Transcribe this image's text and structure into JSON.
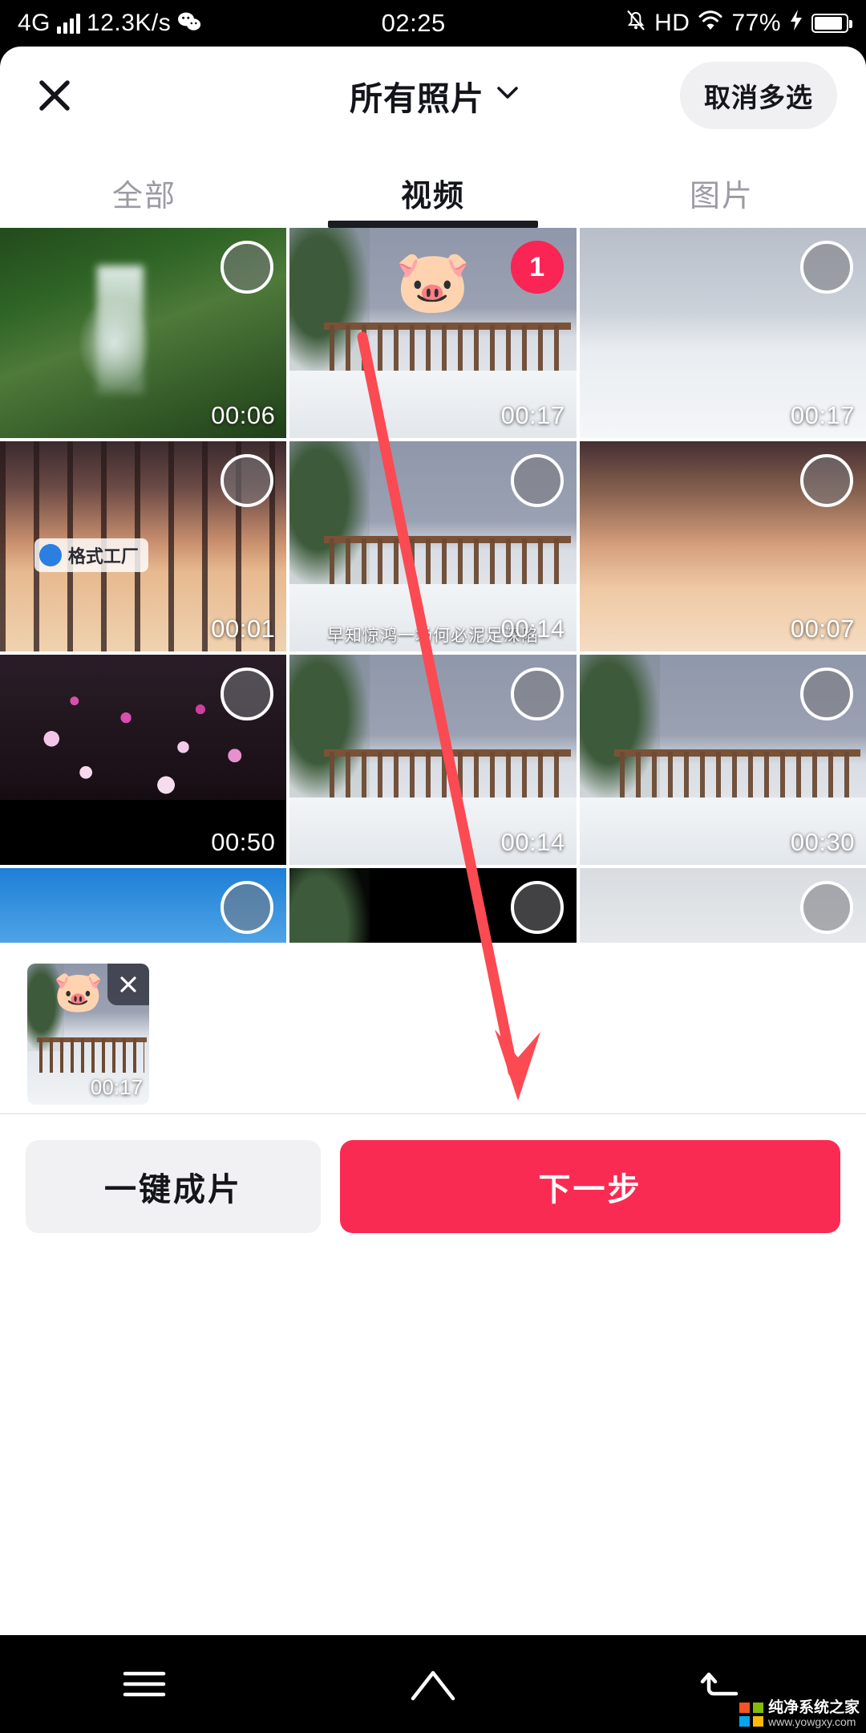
{
  "status_bar": {
    "network_type": "4G",
    "data_rate": "12.3K/s",
    "app_icon": "wechat-icon",
    "time": "02:25",
    "mute_icon": "bell-muted-icon",
    "hd_label": "HD",
    "wifi_icon": "wifi-icon",
    "battery_percent": "77%",
    "charging_icon": "lightning-bolt-icon"
  },
  "header": {
    "close_icon": "close-icon",
    "title": "所有照片",
    "chevron_icon": "chevron-down-icon",
    "multi_select_button": "取消多选"
  },
  "tabs": [
    {
      "label": "全部",
      "active": false
    },
    {
      "label": "视频",
      "active": true
    },
    {
      "label": "图片",
      "active": false
    }
  ],
  "grid": {
    "items": [
      {
        "duration": "00:06",
        "selected": false,
        "badge": "",
        "art": "t-waterfall",
        "sticker": "",
        "watermark": "",
        "caption": ""
      },
      {
        "duration": "00:17",
        "selected": true,
        "badge": "1",
        "art": "t-snow",
        "sticker": "🐷",
        "watermark": "",
        "caption": ""
      },
      {
        "duration": "00:17",
        "selected": false,
        "badge": "",
        "art": "t-snow2",
        "sticker": "",
        "watermark": "",
        "caption": ""
      },
      {
        "duration": "00:01",
        "selected": false,
        "badge": "",
        "art": "t-sunset",
        "sticker": "",
        "watermark": "格式工厂",
        "caption": ""
      },
      {
        "duration": "00:14",
        "selected": false,
        "badge": "",
        "art": "t-snow",
        "sticker": "",
        "watermark": "",
        "caption": "早知惊鸿一场何必泥足深陷"
      },
      {
        "duration": "00:07",
        "selected": false,
        "badge": "",
        "art": "t-sunset2",
        "sticker": "",
        "watermark": "",
        "caption": ""
      },
      {
        "duration": "00:50",
        "selected": false,
        "badge": "",
        "art": "t-blossom",
        "sticker": "",
        "watermark": "",
        "caption": ""
      },
      {
        "duration": "00:14",
        "selected": false,
        "badge": "",
        "art": "t-snow",
        "sticker": "",
        "watermark": "",
        "caption": ""
      },
      {
        "duration": "00:30",
        "selected": false,
        "badge": "",
        "art": "t-snow",
        "sticker": "",
        "watermark": "",
        "caption": ""
      },
      {
        "duration": "",
        "selected": false,
        "badge": "",
        "art": "t-birds",
        "sticker": "",
        "watermark": "",
        "caption": ""
      },
      {
        "duration": "",
        "selected": false,
        "badge": "",
        "art": "t-snow",
        "sticker": "",
        "watermark": "",
        "caption": ""
      },
      {
        "duration": "",
        "selected": false,
        "badge": "",
        "art": "t-clouds",
        "sticker": "",
        "watermark": "",
        "caption": ""
      }
    ]
  },
  "selected_tray": {
    "item": {
      "duration": "00:17",
      "sticker": "🐷",
      "remove_icon": "close-icon"
    }
  },
  "bottom_bar": {
    "secondary_button": "一键成片",
    "primary_button": "下一步"
  },
  "nav_bar": {
    "recents_icon": "menu-icon",
    "home_icon": "home-icon",
    "back_icon": "back-icon",
    "watermark_title": "纯净系统之家",
    "watermark_sub": "www.yowgxy.com"
  },
  "annotation": {
    "arrow_icon": "red-arrow-annotation",
    "color": "#fb4a52"
  },
  "colors": {
    "accent_red": "#fa2b53",
    "badge_red": "#fa2455",
    "pill_gray": "#f0f0f2",
    "text_dark": "#14151a",
    "text_muted": "#9b9ba3"
  }
}
